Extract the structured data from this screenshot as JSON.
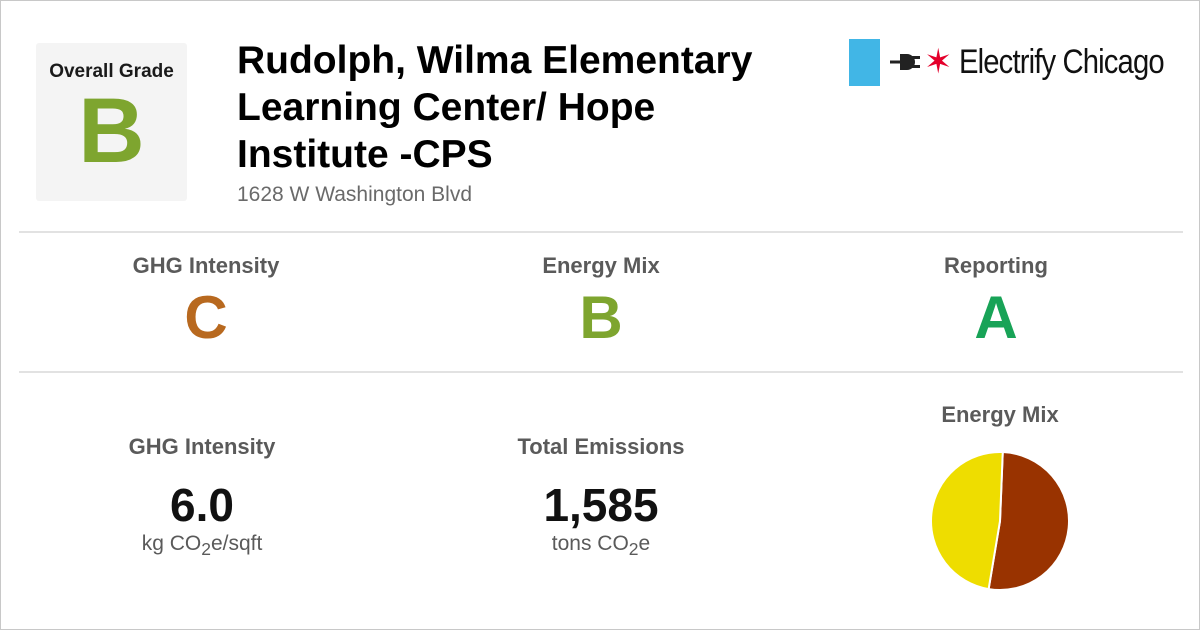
{
  "overall": {
    "label": "Overall Grade",
    "grade": "B",
    "grade_color": "#7ea52f"
  },
  "building": {
    "name_lines": [
      "Rudolph, Wilma Elementary",
      "Learning Center/ Hope",
      "Institute -CPS"
    ],
    "address": "1628 W Washington Blvd"
  },
  "logo": {
    "text": "Electrify Chicago",
    "icons": [
      "chicago-flag-bar-icon",
      "plug-icon",
      "red-star-icon"
    ],
    "colors": {
      "bar": "#41b6e6",
      "star": "#e4002b"
    }
  },
  "grades": [
    {
      "label": "GHG Intensity",
      "grade": "C",
      "color": "#b8691f"
    },
    {
      "label": "Energy Mix",
      "grade": "B",
      "color": "#7ea52f"
    },
    {
      "label": "Reporting",
      "grade": "A",
      "color": "#18a357"
    }
  ],
  "stats": {
    "ghg_intensity": {
      "label": "GHG Intensity",
      "value": "6.0",
      "unit_prefix": "kg CO",
      "unit_sub": "2",
      "unit_suffix": "e/sqft"
    },
    "total_emissions": {
      "label": "Total Emissions",
      "value": "1,585",
      "unit_prefix": "tons CO",
      "unit_sub": "2",
      "unit_suffix": "e"
    }
  },
  "energy_mix": {
    "title": "Energy Mix",
    "chart_data": {
      "type": "pie",
      "slices": [
        {
          "value": 0.52,
          "color": "#993300"
        },
        {
          "value": 0.48,
          "color": "#eedd00"
        }
      ]
    }
  }
}
